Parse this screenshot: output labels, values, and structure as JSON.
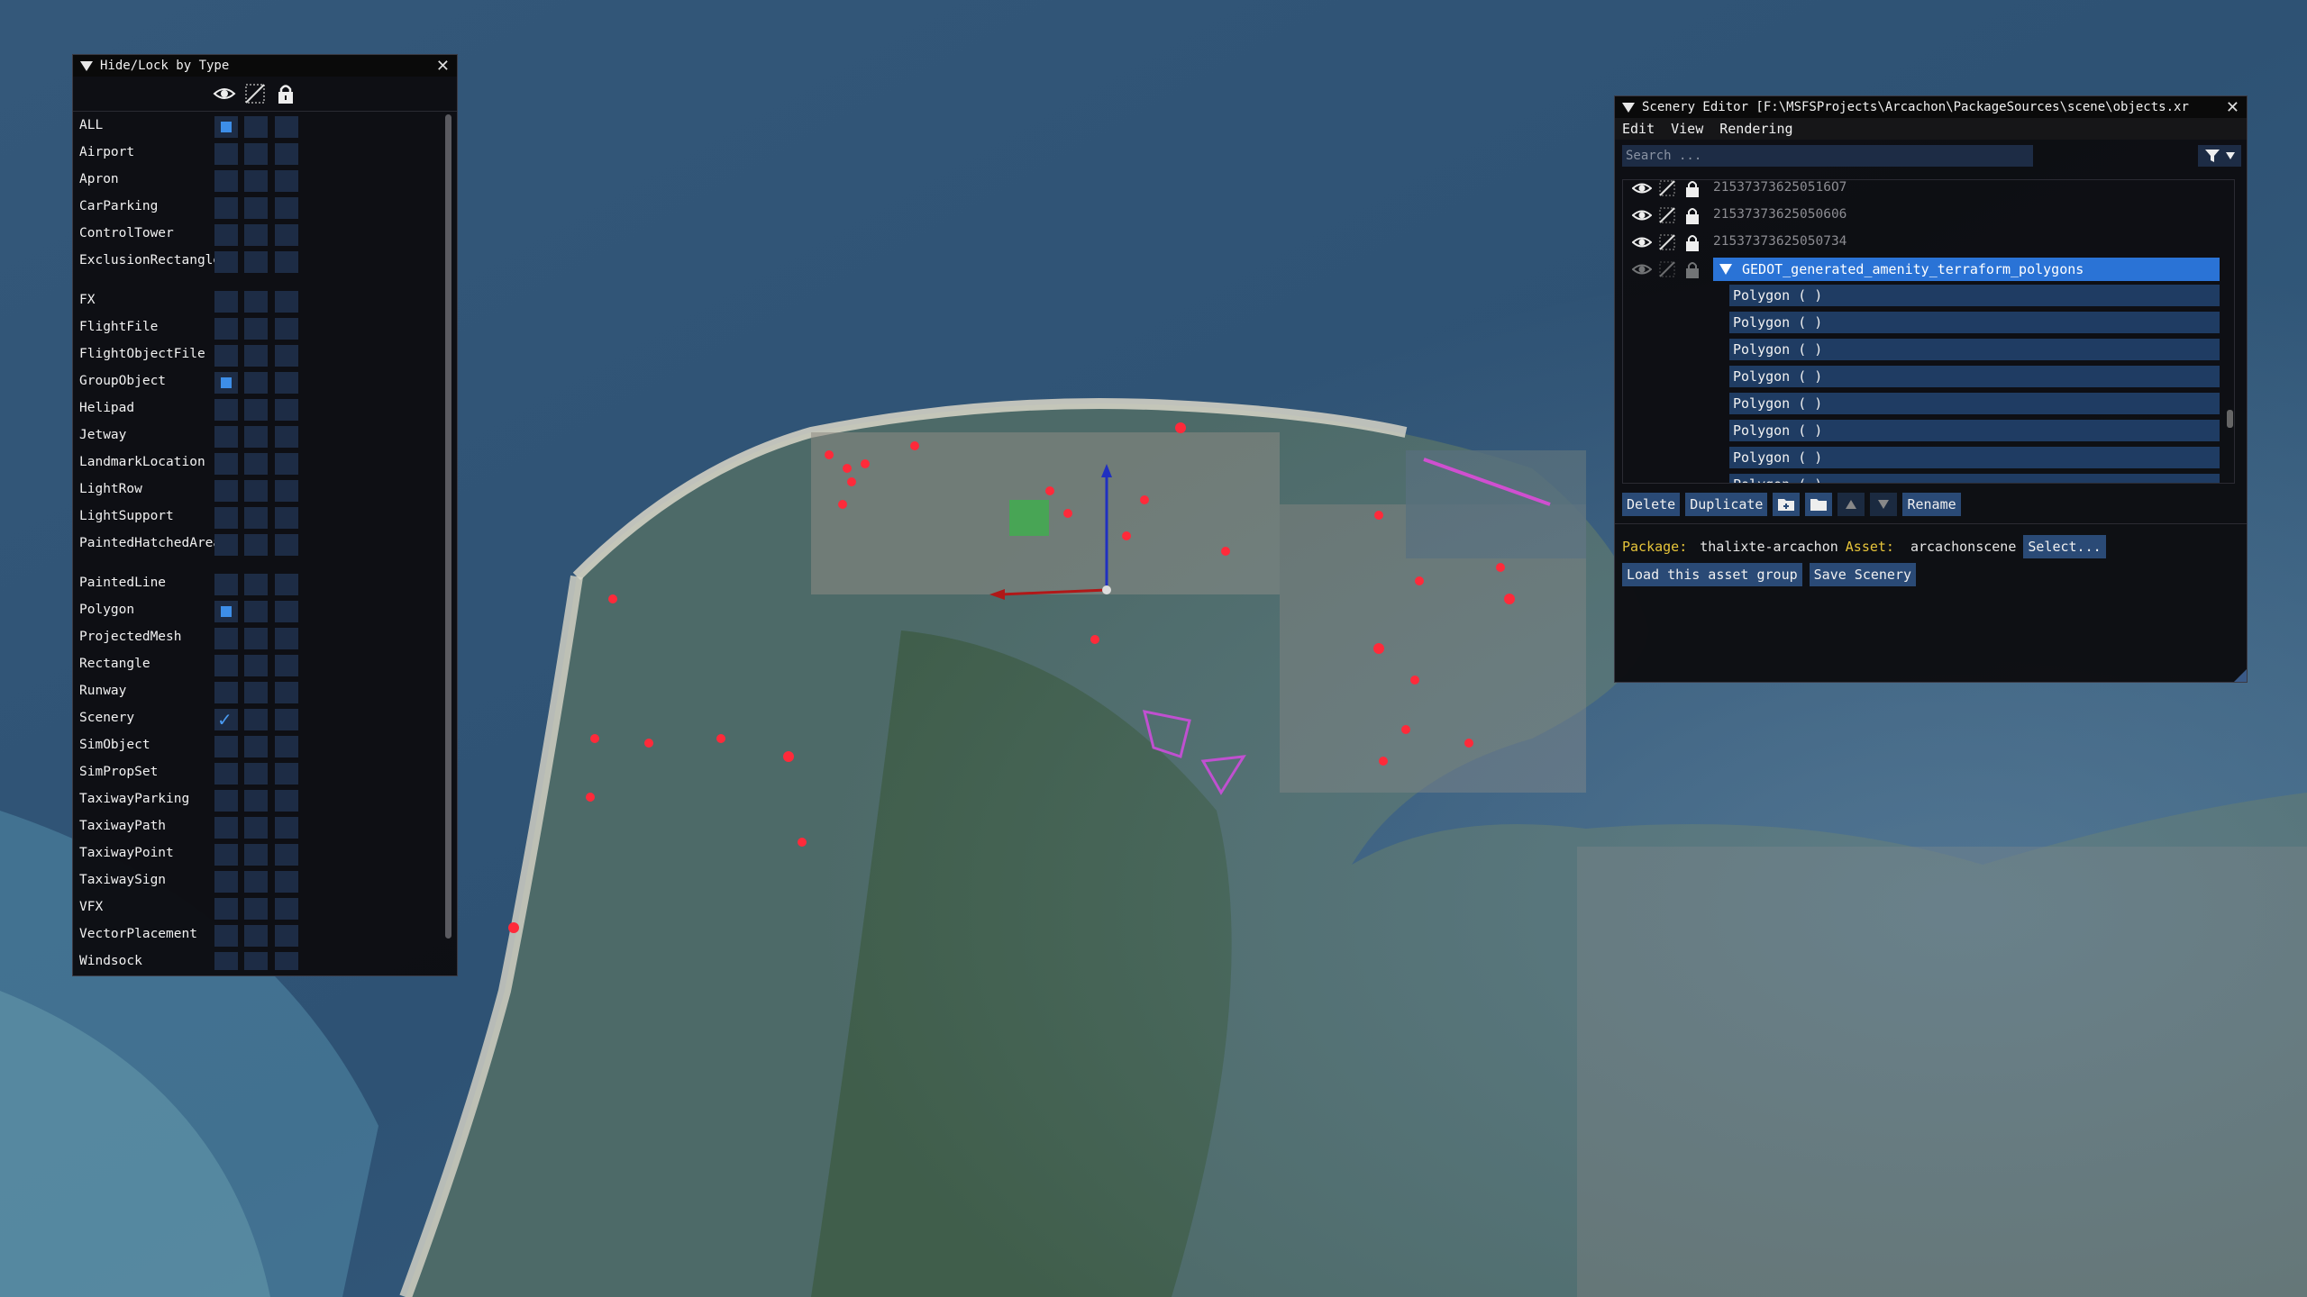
{
  "hidelock": {
    "title": "Hide/Lock by Type",
    "header_icons": [
      "eye-icon",
      "hidden-icon",
      "lock-icon"
    ],
    "rows": [
      {
        "label": "ALL",
        "visible": "square",
        "tall": false
      },
      {
        "label": "Airport",
        "visible": "",
        "tall": false
      },
      {
        "label": "Apron",
        "visible": "",
        "tall": false
      },
      {
        "label": "CarParking",
        "visible": "",
        "tall": false
      },
      {
        "label": "ControlTower",
        "visible": "",
        "tall": false
      },
      {
        "label": "ExclusionRectangle",
        "visible": "",
        "tall": true
      },
      {
        "label": "FX",
        "visible": "",
        "tall": false
      },
      {
        "label": "FlightFile",
        "visible": "",
        "tall": false
      },
      {
        "label": "FlightObjectFile",
        "visible": "",
        "tall": false
      },
      {
        "label": "GroupObject",
        "visible": "square",
        "tall": false
      },
      {
        "label": "Helipad",
        "visible": "",
        "tall": false
      },
      {
        "label": "Jetway",
        "visible": "",
        "tall": false
      },
      {
        "label": "LandmarkLocation",
        "visible": "",
        "tall": false
      },
      {
        "label": "LightRow",
        "visible": "",
        "tall": false
      },
      {
        "label": "LightSupport",
        "visible": "",
        "tall": false
      },
      {
        "label": "PaintedHatchedArea",
        "visible": "",
        "tall": true
      },
      {
        "label": "PaintedLine",
        "visible": "",
        "tall": false
      },
      {
        "label": "Polygon",
        "visible": "square",
        "tall": false
      },
      {
        "label": "ProjectedMesh",
        "visible": "",
        "tall": false
      },
      {
        "label": "Rectangle",
        "visible": "",
        "tall": false
      },
      {
        "label": "Runway",
        "visible": "",
        "tall": false
      },
      {
        "label": "Scenery",
        "visible": "check",
        "tall": false
      },
      {
        "label": "SimObject",
        "visible": "",
        "tall": false
      },
      {
        "label": "SimPropSet",
        "visible": "",
        "tall": false
      },
      {
        "label": "TaxiwayParking",
        "visible": "",
        "tall": false
      },
      {
        "label": "TaxiwayPath",
        "visible": "",
        "tall": false
      },
      {
        "label": "TaxiwayPoint",
        "visible": "",
        "tall": false
      },
      {
        "label": "TaxiwaySign",
        "visible": "",
        "tall": false
      },
      {
        "label": "VFX",
        "visible": "",
        "tall": false
      },
      {
        "label": "VectorPlacement",
        "visible": "",
        "tall": false
      },
      {
        "label": "Windsock",
        "visible": "",
        "tall": false
      }
    ]
  },
  "scenery": {
    "title": "Scenery Editor [F:\\MSFSProjects\\Arcachon\\PackageSources\\scene\\objects.xr",
    "menu": [
      "Edit",
      "View",
      "Rendering"
    ],
    "search_placeholder": "Search ...",
    "tree_items": [
      {
        "name": "215373736250516O7"
      },
      {
        "name": "21537373625050606"
      },
      {
        "name": "21537373625050734"
      }
    ],
    "selected_group": "GEDOT_generated_amenity_terraform_polygons",
    "children": [
      "Polygon  ( )",
      "Polygon  ( )",
      "Polygon  ( )",
      "Polygon  ( )",
      "Polygon  ( )",
      "Polygon  ( )",
      "Polygon  ( )",
      "Polygon  ( )"
    ],
    "buttons": {
      "delete": "Delete",
      "duplicate": "Duplicate",
      "rename": "Rename"
    },
    "package_label": "Package:",
    "package_value": "thalixte-arcachon",
    "asset_label": "Asset:",
    "asset_value": "arcachonscene",
    "select_button": "Select...",
    "load_button": "Load this asset group",
    "save_button": "Save Scenery"
  },
  "colors": {
    "accent": "#2a73d6",
    "button": "#2a4a76",
    "checkbox": "#1d2c45",
    "label_yellow": "#e6c43a"
  }
}
